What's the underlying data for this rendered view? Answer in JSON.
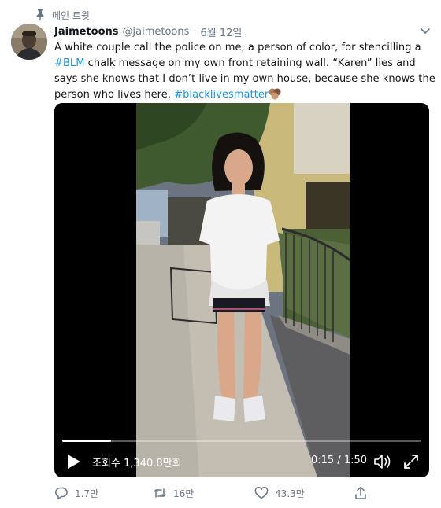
{
  "pinned_label": "메인 트윗",
  "tweet": {
    "display_name": "Jaimetoons",
    "handle": "@jaimetoons",
    "separator": "·",
    "date": "6월 12일",
    "text": {
      "line1": "A white couple call the police on me, a person of color, for stencilling a",
      "hashtag_blm": "#BLM",
      "line2_rest": " chalk message on my own front retaining wall. “Karen” lies and",
      "line3": "says she knows that I don’t live in my own house, because she knows the",
      "line4": "person who lives here. ",
      "hashtag_blacklivesmatter": "#blacklivesmatter"
    }
  },
  "video": {
    "views_label": "조회수 1,340.8만회",
    "time": "0:15 / 1:50",
    "progress": 0.136
  },
  "actions": {
    "reply_count": "1.7만",
    "retweet_count": "16만",
    "like_count": "43.3만"
  },
  "colors": {
    "link": "#1b95e0",
    "secondary_text": "#657786"
  }
}
